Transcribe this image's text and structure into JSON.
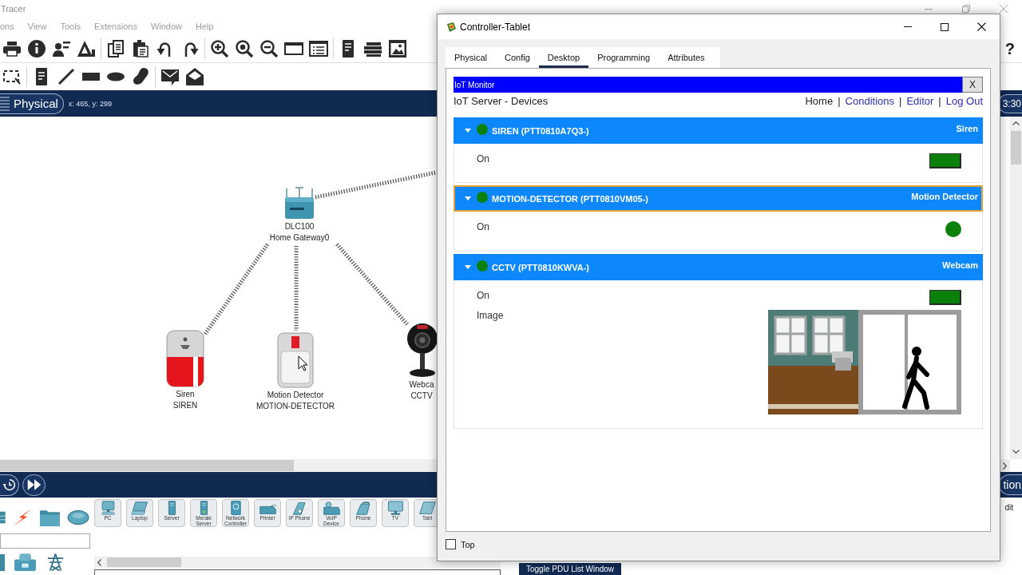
{
  "app": {
    "title": "Tracer",
    "menu": [
      "ons",
      "View",
      "Tools",
      "Extensions",
      "Window",
      "Help"
    ],
    "help": "?",
    "workspace_bar": {
      "mode": "Physical",
      "coordinates": "x: 465, y: 299",
      "clock": "3:30"
    },
    "canvas": {
      "devices": [
        {
          "kind": "gateway",
          "model": "DLC100",
          "name": "Home Gateway0"
        },
        {
          "kind": "siren",
          "model": "Siren",
          "name": "SIREN"
        },
        {
          "kind": "motion_detector",
          "model": "Motion Detector",
          "name": "MOTION-DETECTOR"
        },
        {
          "kind": "webcam",
          "model": "Webca",
          "name": "CCTV"
        }
      ]
    },
    "simulation_bar": {
      "mode": "tion"
    },
    "palette": {
      "devices": [
        {
          "kind": "pc",
          "label": "PC"
        },
        {
          "kind": "laptop",
          "label": "Laptop"
        },
        {
          "kind": "server",
          "label": "Server"
        },
        {
          "kind": "meraki",
          "label": "Meraki Server"
        },
        {
          "kind": "controller",
          "label": "Network Controller"
        },
        {
          "kind": "printer",
          "label": "Printer"
        },
        {
          "kind": "ipphone",
          "label": "IP Phone"
        },
        {
          "kind": "voip",
          "label": "VoIP Device"
        },
        {
          "kind": "phone",
          "label": "Phone"
        },
        {
          "kind": "tv",
          "label": "TV"
        },
        {
          "kind": "tablet",
          "label": "Tabl"
        }
      ],
      "side_label": "dit"
    },
    "pdu_button": "Toggle PDU List Window"
  },
  "tablet": {
    "title": "Controller-Tablet",
    "tabs": [
      {
        "label": "Physical",
        "selected": false
      },
      {
        "label": "Config",
        "selected": false
      },
      {
        "label": "Desktop",
        "selected": true
      },
      {
        "label": "Programming",
        "selected": false
      },
      {
        "label": "Attributes",
        "selected": false
      }
    ],
    "monitor": {
      "title": "IoT Monitor",
      "close": "X",
      "heading": "IoT Server - Devices",
      "nav": [
        {
          "label": "Home",
          "kind": "current"
        },
        {
          "label": "|",
          "kind": "separator"
        },
        {
          "label": "Conditions",
          "kind": "link"
        },
        {
          "label": "|",
          "kind": "separator"
        },
        {
          "label": "Editor",
          "kind": "link"
        },
        {
          "label": "|",
          "kind": "separator"
        },
        {
          "label": "Log Out",
          "kind": "link"
        }
      ],
      "devices": [
        {
          "name": "SIREN (PTT0810A7Q3-)",
          "type": "Siren",
          "online": true,
          "expanded": true,
          "selected": false,
          "properties": [
            {
              "label": "On",
              "kind": "switch",
              "on": true
            }
          ]
        },
        {
          "name": "MOTION-DETECTOR (PTT0810VM05-)",
          "type": "Motion Detector",
          "online": true,
          "expanded": true,
          "selected": true,
          "properties": [
            {
              "label": "On",
              "kind": "light",
              "on": true
            }
          ]
        },
        {
          "name": "CCTV (PTT0810KWVA-)",
          "type": "Webcam",
          "online": true,
          "expanded": true,
          "selected": false,
          "properties": [
            {
              "label": "On",
              "kind": "switch",
              "on": true
            },
            {
              "label": "Image",
              "kind": "image"
            }
          ]
        }
      ]
    },
    "top_checkbox": {
      "label": "Top",
      "checked": false
    }
  }
}
